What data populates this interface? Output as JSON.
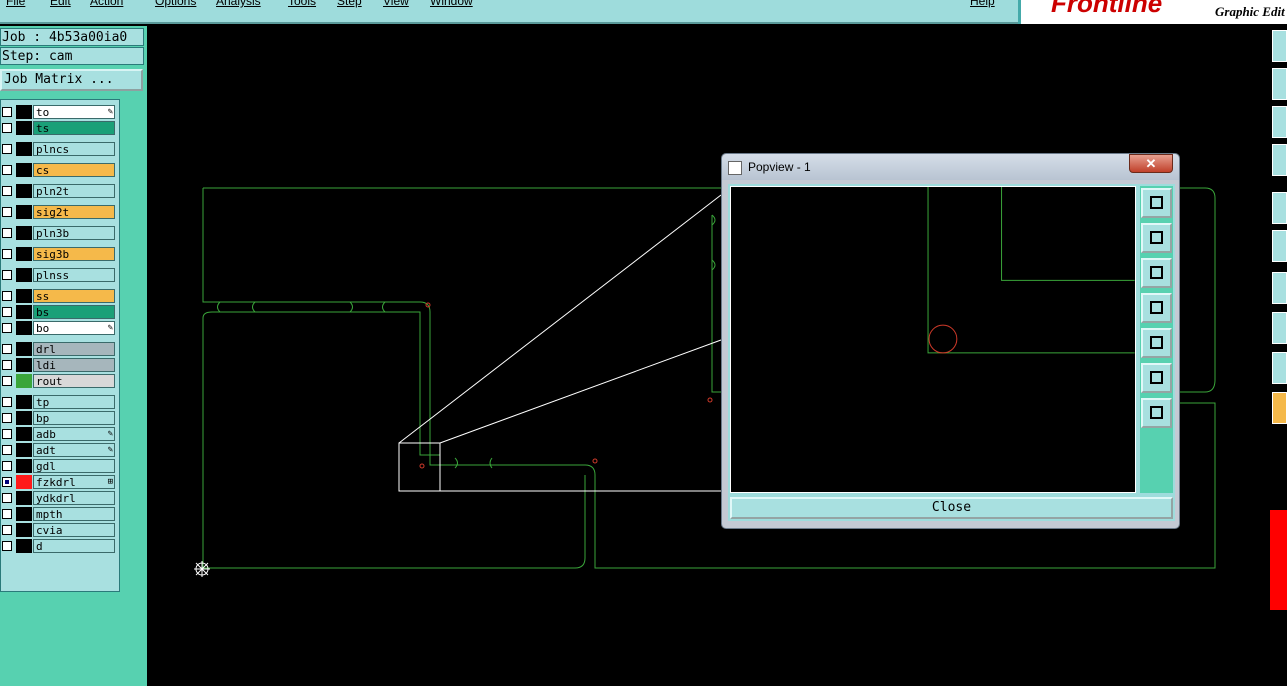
{
  "menu": [
    "File",
    "Edit",
    "Action",
    "Options",
    "Analysis",
    "Tools",
    "Step",
    "View",
    "Window",
    "Help"
  ],
  "brand": {
    "logo": "Frontline",
    "subtitle": "Graphic Edit"
  },
  "job": {
    "job_line": "Job : 4b53a00ia0",
    "step_line": "Step: cam"
  },
  "job_matrix_button": "Job Matrix ...",
  "layers": [
    {
      "name": "to",
      "bg": "#ffffff",
      "mark": "✎"
    },
    {
      "name": "ts",
      "bg": "#1aa078",
      "mark": ""
    },
    {
      "name": "plncs",
      "bg": "#a8e0e0",
      "mark": ""
    },
    {
      "name": "cs",
      "bg": "#f5b94a",
      "mark": ""
    },
    {
      "name": "pln2t",
      "bg": "#a8e0e0",
      "mark": ""
    },
    {
      "name": "sig2t",
      "bg": "#f5b94a",
      "mark": ""
    },
    {
      "name": "pln3b",
      "bg": "#a8e0e0",
      "mark": ""
    },
    {
      "name": "sig3b",
      "bg": "#f5b94a",
      "mark": ""
    },
    {
      "name": "plnss",
      "bg": "#a8e0e0",
      "mark": ""
    },
    {
      "name": "ss",
      "bg": "#f5b94a",
      "mark": ""
    },
    {
      "name": "bs",
      "bg": "#1aa078",
      "mark": ""
    },
    {
      "name": "bo",
      "bg": "#ffffff",
      "mark": "✎"
    },
    {
      "name": "drl",
      "bg": "#a6b6bc",
      "mark": ""
    },
    {
      "name": "ldi",
      "bg": "#a6b6bc",
      "mark": ""
    },
    {
      "name": "rout",
      "bg": "#d8d8d8",
      "mark": ""
    },
    {
      "name": "tp",
      "bg": "#a8e0e0",
      "mark": ""
    },
    {
      "name": "bp",
      "bg": "#a8e0e0",
      "mark": ""
    },
    {
      "name": "adb",
      "bg": "#a8e0e0",
      "mark": "✎"
    },
    {
      "name": "adt",
      "bg": "#a8e0e0",
      "mark": "✎"
    },
    {
      "name": "gdl",
      "bg": "#a8e0e0",
      "mark": ""
    },
    {
      "name": "fzkdrl",
      "bg": "#a8e0e0",
      "mark": "⊞"
    },
    {
      "name": "ydkdrl",
      "bg": "#a8e0e0",
      "mark": ""
    },
    {
      "name": "mpth",
      "bg": "#a8e0e0",
      "mark": ""
    },
    {
      "name": "cvia",
      "bg": "#a8e0e0",
      "mark": ""
    },
    {
      "name": "d",
      "bg": "#a8e0e0",
      "mark": ""
    }
  ],
  "popview": {
    "title": "Popview - 1",
    "close_x": "✕",
    "close_button": "Close"
  },
  "popview_tools": [
    "zoom-fit-icon",
    "pan-up-icon",
    "pan-down-icon",
    "pan-left-icon",
    "pan-right-icon",
    "zoom-in-icon",
    "zoom-out-icon"
  ],
  "colors": {
    "panel": "#57d1b0",
    "button": "#a8e0e0",
    "outline": "#3aa53a",
    "pad": "#d03a2a"
  }
}
